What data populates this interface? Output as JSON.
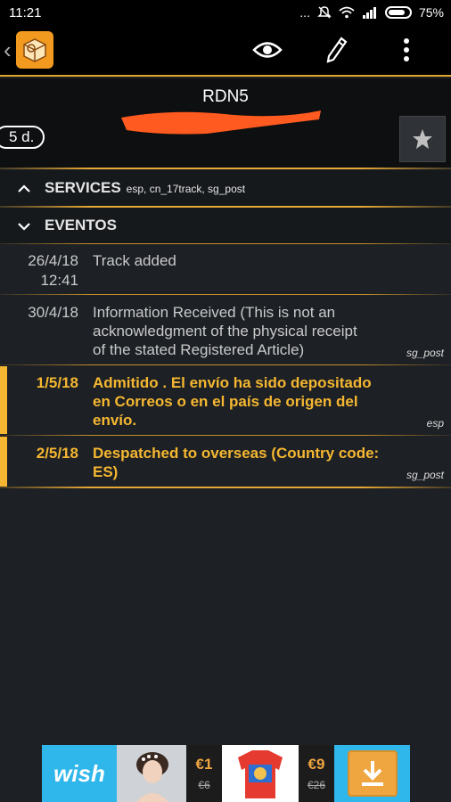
{
  "status_bar": {
    "time": "11:21",
    "dots": "...",
    "battery": "75%"
  },
  "toolbar": {
    "back_icon": "chevron-left-icon",
    "logo_icon": "package-icon",
    "actions": [
      "eye-icon",
      "pencil-icon",
      "more-vert-icon"
    ]
  },
  "header": {
    "title": "RDN5",
    "days_badge": "5 d.",
    "star_icon": "star-icon"
  },
  "services": {
    "label": "SERVICES",
    "sources": "esp, cn_17track, sg_post"
  },
  "eventos": {
    "label": "EVENTOS"
  },
  "events": [
    {
      "date": "26/4/18",
      "time": "12:41",
      "text": "Track added",
      "source": ""
    },
    {
      "date": "30/4/18",
      "time": "",
      "text_lines": [
        "Information Received (This is not an",
        "acknowledgment of the physical receipt",
        "of the stated Registered Article)"
      ],
      "source": "sg_post"
    },
    {
      "date": "1/5/18",
      "time": "",
      "text_lines": [
        "Admitido . El envío ha sido depositado",
        "en Correos o en el país de origen del",
        "envío."
      ],
      "source": "esp"
    },
    {
      "date": "2/5/18",
      "time": "",
      "text_lines": [
        "Despatched to overseas (Country code:",
        "ES)"
      ],
      "source": "sg_post"
    }
  ],
  "ad": {
    "brand": "wish",
    "item1": {
      "price": "€1",
      "old_price": "€6"
    },
    "item2": {
      "price": "€9",
      "old_price": "€26"
    },
    "download_icon": "download-icon"
  },
  "colors": {
    "accent": "#f5b731",
    "background": "#1d2024",
    "toolbar": "#000000"
  }
}
